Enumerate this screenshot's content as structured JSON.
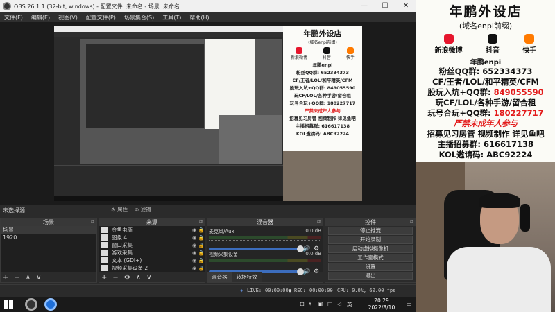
{
  "obs": {
    "title": "OBS 26.1.1 (32-bit, windows) - 配置文件: 未命名 - 场景: 未命名",
    "menu": [
      "文件(F)",
      "编辑(E)",
      "视图(V)",
      "配置文件(P)",
      "场景集合(S)",
      "工具(T)",
      "帮助(H)"
    ],
    "no_source": "未选择源",
    "properties": "属性",
    "filters": "滤镜",
    "scenes": {
      "header": "场景",
      "items": [
        "场景",
        "1920"
      ]
    },
    "sources": {
      "header": "来源",
      "items": [
        "金鱼电商",
        "图象 4",
        "窗口采集",
        "游戏采集",
        "文本 (GDI+)",
        "视频采集设备 2"
      ]
    },
    "mixer": {
      "header": "混音器",
      "channels": [
        {
          "name": "麦克风/Aux",
          "db": "0.0 dB"
        },
        {
          "name": "视频采集设备",
          "db": "0.0 dB"
        }
      ],
      "tabs": [
        "混音器",
        "转场特效"
      ]
    },
    "controls": {
      "header": "控件",
      "buttons": [
        "停止推流",
        "开始录制",
        "启动虚拟摄像机",
        "工作室模式",
        "设置",
        "退出"
      ]
    },
    "status": {
      "live_label": "LIVE:",
      "live_time": "00:00:00",
      "rec_label": "REC:",
      "rec_time": "00:00:00",
      "cpu": "CPU: 0.0%, 60.00 fps"
    }
  },
  "taskbar": {
    "lang": "英",
    "time": "20:29",
    "date": "2022/8/10"
  },
  "poster": {
    "title": "年鹏外设店",
    "subtitle": "(域名enpi前缀)",
    "icons": [
      {
        "label": "新浪微博",
        "color": "#e6162d"
      },
      {
        "label": "抖音",
        "color": "#111111"
      },
      {
        "label": "快手",
        "color": "#ff7a00"
      }
    ],
    "store": "年鹏enpi",
    "lines": [
      {
        "text": "粉丝QQ群: 652334373",
        "red": false
      },
      {
        "text": "CF/王者/LOL/和平精英/CFM",
        "red": false
      },
      {
        "text": "股玩入坑+QQ群: 849055590",
        "red": false,
        "red_part": "849055590"
      },
      {
        "text": "玩CF/LOL/各种手游/留合租",
        "red": false
      },
      {
        "text": "玩号合玩+QQ群: 180227717",
        "red": false,
        "red_part": "180227717"
      },
      {
        "text": "严禁未成年人参与",
        "red": true
      },
      {
        "text": "招募见习房管 视频制作 详见鱼吧",
        "red": false
      },
      {
        "text": "主播招募群: 616617138",
        "red": false
      },
      {
        "text": "KOL邀请码: ABC92224",
        "red": false
      }
    ]
  },
  "colors": {
    "obs_bg": "#2b2b2b",
    "accent_red": "#e31b1b",
    "fader_blue": "#3c6dbd"
  }
}
